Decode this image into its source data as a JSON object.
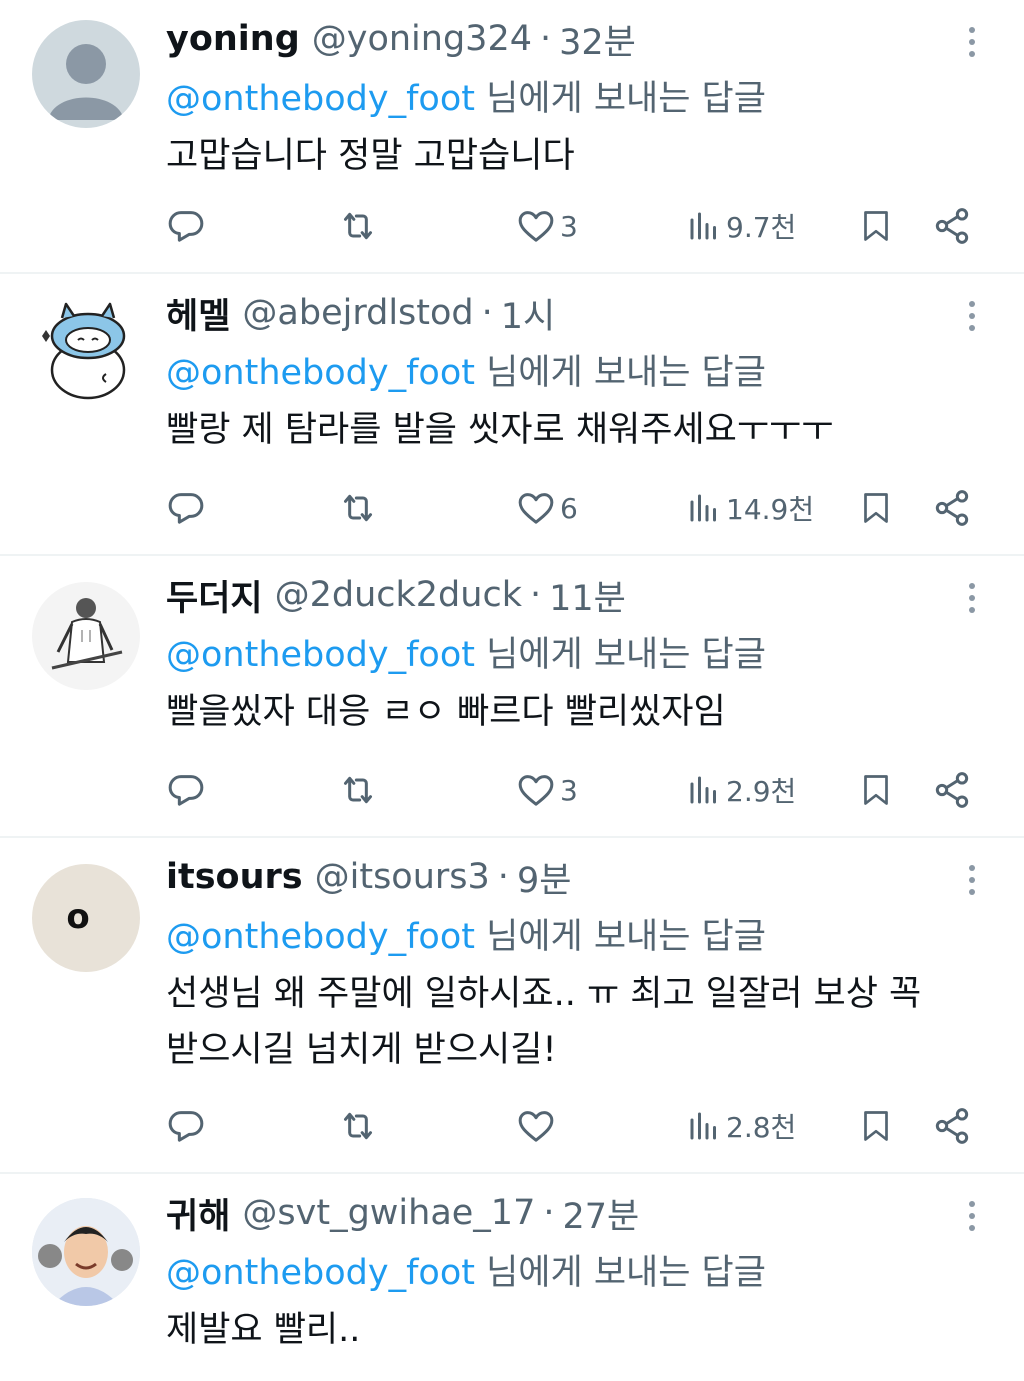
{
  "replying_suffix": "님에게 보내는 답글",
  "separator": "·",
  "tweets": [
    {
      "name": "yoning",
      "handle": "@yoning324",
      "time": "32분",
      "mention": "@onthebody_foot",
      "text": "고맙습니다 정말 고맙습니다",
      "likes": "3",
      "views": "9.7천",
      "avatar": "default-profile"
    },
    {
      "name": "헤멜",
      "handle": "@abejrdlstod",
      "time": "1시",
      "mention": "@onthebody_foot",
      "text": "빨랑 제 탐라를 발을 씻자로 채워주세요ㅜㅜㅜ",
      "likes": "6",
      "views": "14.9천",
      "avatar": "blue-hat-creature"
    },
    {
      "name": "두더지",
      "handle": "@2duck2duck",
      "time": "11분",
      "mention": "@onthebody_foot",
      "text": "빨을씼자 대응 ㄹㅇ 빠르다 빨리씼자임",
      "likes": "3",
      "views": "2.9천",
      "avatar": "baseball-player-sketch"
    },
    {
      "name": "itsours",
      "handle": "@itsours3",
      "time": "9분",
      "mention": "@onthebody_foot",
      "text": "선생님 왜 주말에 일하시죠.. ㅠ 최고 일잘러 보상 꼭 받으시길 넘치게 받으시길!",
      "likes": "",
      "views": "2.8천",
      "avatar": "letter-o-circle",
      "avatar_text": "o"
    },
    {
      "name": "귀해",
      "handle": "@svt_gwihae_17",
      "time": "27분",
      "mention": "@onthebody_foot",
      "text": "제발요 빨리..",
      "likes": "",
      "views": "",
      "avatar": "person-photo"
    }
  ],
  "colors": {
    "text": "#0f1419",
    "secondary": "#536471",
    "link": "#1d9bf0",
    "divider": "#eff3f4"
  }
}
